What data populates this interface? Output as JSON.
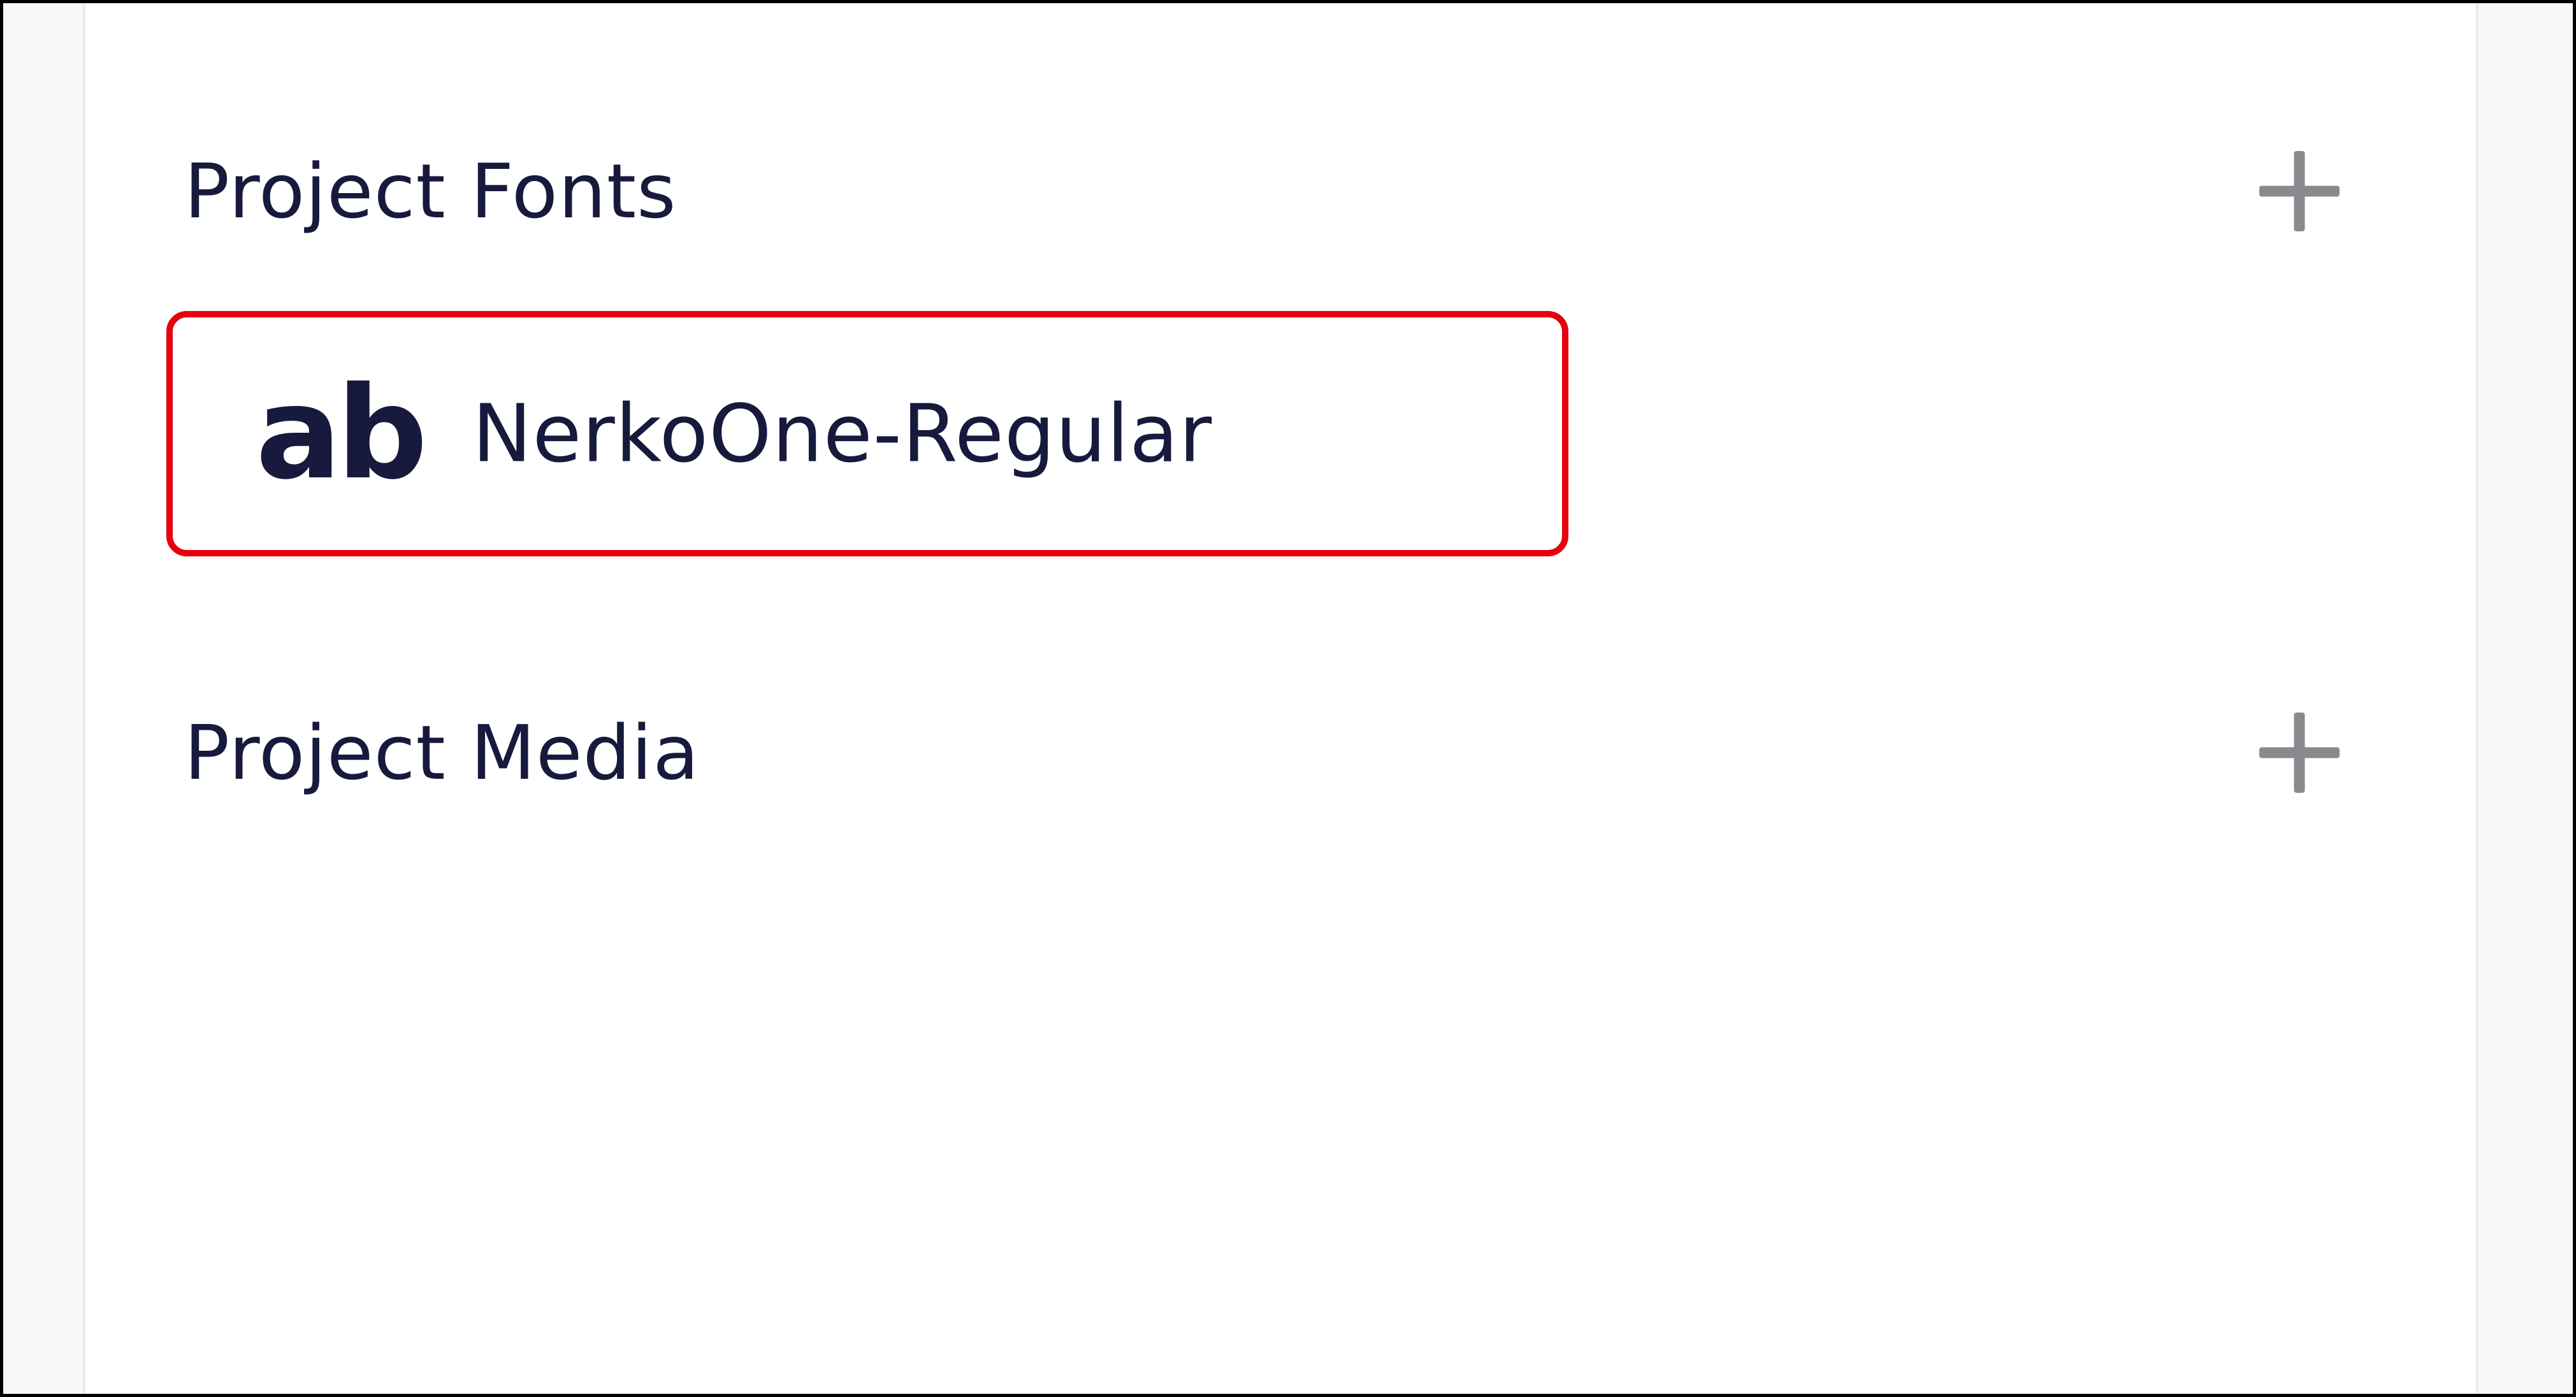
{
  "fonts_section": {
    "title": "Project Fonts",
    "add_icon": "plus-icon",
    "items": [
      {
        "preview": "ab",
        "name": "NerkoOne-Regular",
        "icon": "font-preview-icon"
      }
    ]
  },
  "media_section": {
    "title": "Project Media",
    "add_icon": "plus-icon"
  },
  "colors": {
    "text": "#171a3c",
    "icon": "#8a8a8e",
    "highlight": "#e5000b",
    "gutter": "#f8f8fb"
  }
}
